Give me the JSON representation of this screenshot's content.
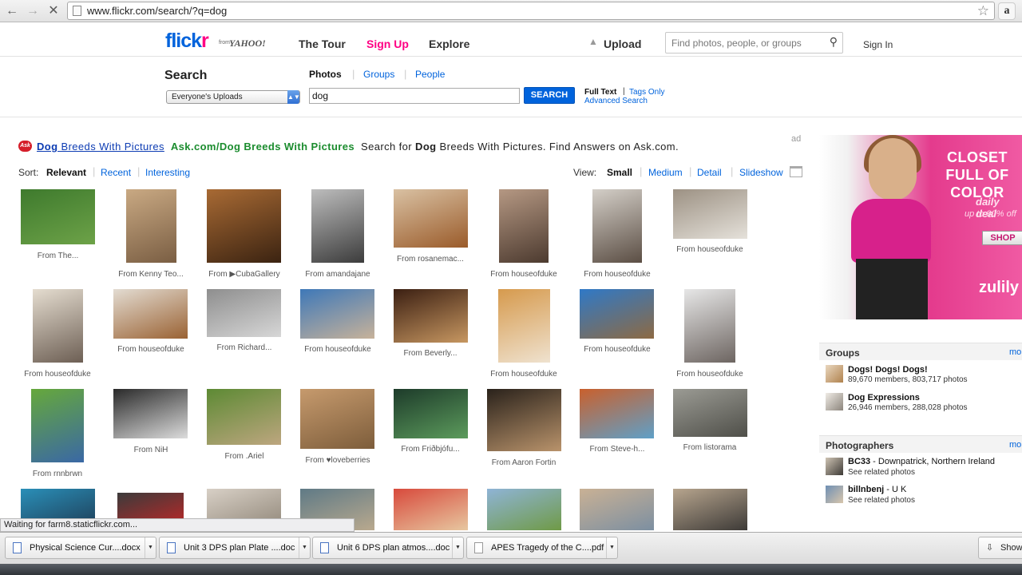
{
  "browser": {
    "url": "www.flickr.com/search/?q=dog",
    "back_icon": "back-arrow-icon",
    "forward_icon": "forward-arrow-icon",
    "stop_icon": "stop-icon"
  },
  "header": {
    "logo_main": "flick",
    "logo_r": "r",
    "logo_from": "from",
    "logo_yahoo": "YAHOO!",
    "nav": {
      "tour": "The Tour",
      "signup": "Sign Up",
      "explore": "Explore",
      "upload": "Upload"
    },
    "search_placeholder": "Find photos, people, or groups",
    "signin": "Sign In"
  },
  "search": {
    "title": "Search",
    "tabs": {
      "photos": "Photos",
      "groups": "Groups",
      "people": "People"
    },
    "scope": "Everyone's Uploads",
    "query": "dog",
    "button": "SEARCH",
    "full_text": "Full Text",
    "tags_only": "Tags Only",
    "advanced": "Advanced Search"
  },
  "ad_line": {
    "link_keyword": "Dog",
    "link_rest": "Breeds With Pictures",
    "url_text": "Ask.com/Dog Breeds With Pictures",
    "text_before": "Search for",
    "text_keyword": "Dog",
    "text_after": "Breeds With Pictures. Find Answers on Ask.com.",
    "ad_label": "ad"
  },
  "sort": {
    "label": "Sort:",
    "relevant": "Relevant",
    "recent": "Recent",
    "interesting": "Interesting"
  },
  "view": {
    "label": "View:",
    "small": "Small",
    "medium": "Medium",
    "detail": "Detail",
    "slideshow": "Slideshow"
  },
  "photos": [
    {
      "caption": "From The...",
      "colors": [
        "#3e7a2d",
        "#6da248"
      ]
    },
    {
      "caption": "From Kenny Teo...",
      "colors": [
        "#c9a983",
        "#7a5e43"
      ]
    },
    {
      "caption": "From ▶CubaGallery",
      "colors": [
        "#a86a34",
        "#3b2311"
      ]
    },
    {
      "caption": "From amandajane",
      "colors": [
        "#bdbdbd",
        "#3c3c3c"
      ]
    },
    {
      "caption": "From rosanemac...",
      "colors": [
        "#d9c1a3",
        "#9a5b2a"
      ]
    },
    {
      "caption": "From houseofduke",
      "colors": [
        "#b59883",
        "#4c3a2f"
      ]
    },
    {
      "caption": "From houseofduke",
      "colors": [
        "#d4cfc8",
        "#5b4e44"
      ]
    },
    {
      "caption": "From houseofduke",
      "colors": [
        "#9c9183",
        "#e5e1da"
      ]
    },
    {
      "caption": "From houseofduke",
      "colors": [
        "#e5ddd0",
        "#6d5f54"
      ]
    },
    {
      "caption": "From houseofduke",
      "colors": [
        "#e3dcd2",
        "#9a6233"
      ]
    },
    {
      "caption": "From Richard...",
      "colors": [
        "#8e8e8e",
        "#d7d7d7"
      ]
    },
    {
      "caption": "From houseofduke",
      "colors": [
        "#3e78b8",
        "#c7b29a"
      ]
    },
    {
      "caption": "From Beverly...",
      "colors": [
        "#3b1f12",
        "#c79761"
      ]
    },
    {
      "caption": "From houseofduke",
      "colors": [
        "#d69a4d",
        "#efe2cf"
      ]
    },
    {
      "caption": "From houseofduke",
      "colors": [
        "#2f79c7",
        "#8d6a43"
      ]
    },
    {
      "caption": "From houseofduke",
      "colors": [
        "#e7e7e7",
        "#6d6561"
      ]
    },
    {
      "caption": "From rnnbrwn",
      "colors": [
        "#66a83b",
        "#3a68a5"
      ]
    },
    {
      "caption": "From NiH",
      "colors": [
        "#2a2a2a",
        "#dcdcdc"
      ]
    },
    {
      "caption": "From .Ariel",
      "colors": [
        "#5d8a34",
        "#bda67f"
      ]
    },
    {
      "caption": "From ♥loveberries",
      "colors": [
        "#c69a6d",
        "#7d5d3b"
      ]
    },
    {
      "caption": "From Friðbjófu...",
      "colors": [
        "#1d3b2a",
        "#5c9b5c"
      ]
    },
    {
      "caption": "From Aaron Fortin",
      "colors": [
        "#2a221b",
        "#b9936b"
      ]
    },
    {
      "caption": "From Steve-h...",
      "colors": [
        "#c9602d",
        "#5fa0c8"
      ]
    },
    {
      "caption": "From listorama",
      "colors": [
        "#9b9b94",
        "#4f4f49"
      ]
    },
    {
      "caption": "",
      "colors": [
        "#2a8fb8",
        "#1e3b54"
      ]
    },
    {
      "caption": "",
      "colors": [
        "#3b3b3b",
        "#c42626"
      ]
    },
    {
      "caption": "",
      "colors": [
        "#d8d0c6",
        "#8f8577"
      ]
    },
    {
      "caption": "",
      "colors": [
        "#5f7a86",
        "#b9a98e"
      ]
    },
    {
      "caption": "",
      "colors": [
        "#d84a3c",
        "#e7c7a0"
      ]
    },
    {
      "caption": "",
      "colors": [
        "#8fb4d6",
        "#6f9a46"
      ]
    },
    {
      "caption": "",
      "colors": [
        "#c9b195",
        "#7c8fa1"
      ]
    },
    {
      "caption": "",
      "colors": [
        "#b7a58e",
        "#3d3a37"
      ]
    }
  ],
  "sidebar_ad": {
    "title": "CLOSET FULL OF COLOR",
    "daily": "daily deal",
    "upto": "up to 90% off",
    "shop": "SHOP",
    "brand": "zulily"
  },
  "groups": {
    "title": "Groups",
    "more": "mo",
    "items": [
      {
        "name": "Dogs! Dogs! Dogs!",
        "members": "89,670 members",
        "photos": "803,717 photos"
      },
      {
        "name": "Dog Expressions",
        "members": "26,946 members",
        "photos": "288,028 photos"
      }
    ]
  },
  "photographers": {
    "title": "Photographers",
    "more": "mo",
    "items": [
      {
        "name": "BC33",
        "location": "Downpatrick, Northern Ireland",
        "sub": "See related photos"
      },
      {
        "name": "billnbenj",
        "location": "U K",
        "sub": "See related photos"
      }
    ]
  },
  "status": "Waiting for farm8.staticflickr.com...",
  "downloads": [
    {
      "label": "Physical Science Cur....docx",
      "type": "doc"
    },
    {
      "label": "Unit 3 DPS plan Plate ....doc",
      "type": "doc"
    },
    {
      "label": "Unit 6 DPS plan atmos....doc",
      "type": "doc"
    },
    {
      "label": "APES Tragedy of the C....pdf",
      "type": "pdf"
    }
  ],
  "show_all": "Show"
}
